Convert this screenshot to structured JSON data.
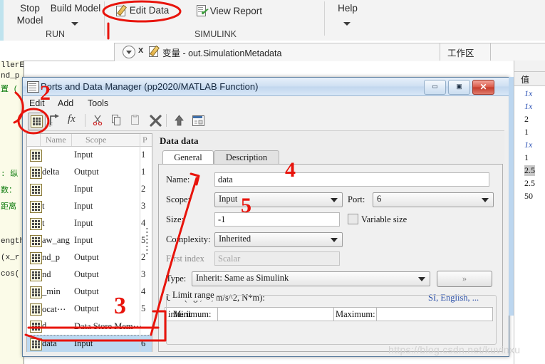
{
  "ribbon": {
    "groups": [
      {
        "caption": "RUN",
        "items": [
          {
            "label_line1": "Stop",
            "label_line2": "Model",
            "icon": "stop-model-icon"
          },
          {
            "label_line1": "Build Model",
            "label_line2": "",
            "icon": "build-model-icon",
            "has_caret": true
          }
        ]
      },
      {
        "caption": "SIMULINK",
        "items": [
          {
            "label_line1": "Edit Data",
            "label_line2": "",
            "icon": "edit-data-icon"
          },
          {
            "label_line1": "View Report",
            "label_line2": "",
            "icon": "view-report-icon"
          }
        ]
      }
    ],
    "help": {
      "label": "Help",
      "has_caret": true
    },
    "run_caption": "RUN",
    "simulink_caption": "SIMULINK",
    "stop_model_l1": "Stop",
    "stop_model_l2": "Model",
    "build_model": "Build Model",
    "edit_data": "Edit Data",
    "view_report": "View Report"
  },
  "tabstrip": {
    "close_glyph": "x",
    "doc_label": "变量 - out.SimulationMetadata",
    "workspace_label": "工作区"
  },
  "bg_editor": {
    "lines": [
      "nd_p",
      "置 (",
      "",
      "",
      ": 纵",
      "数：",
      "距离",
      "",
      "ength",
      "(x_r",
      "cos("
    ],
    "top_line": "llerE"
  },
  "bg_workspace": {
    "header": "值",
    "values": [
      "1x",
      "1x",
      "2",
      "1",
      "1x",
      "1",
      "2.5",
      "2.5",
      "50"
    ],
    "selected_index": 6
  },
  "dialog": {
    "title": "Ports and Data Manager (pp2020/MATLAB Function)",
    "title_icon": "grid-table-icon",
    "window_buttons": {
      "minimize": "minimize-button",
      "maximize": "maximize-button",
      "close": "close-button",
      "close_glyph": "✕"
    },
    "menu": [
      "Edit",
      "Add",
      "Tools"
    ],
    "toolbar": [
      {
        "name": "add-data-icon",
        "pressed": true
      },
      {
        "name": "add-event-icon",
        "pressed": false
      },
      {
        "name": "add-function-icon",
        "pressed": false
      },
      {
        "name": "cut-icon",
        "pressed": false
      },
      {
        "name": "copy-icon",
        "pressed": false
      },
      {
        "name": "paste-icon",
        "pressed": false
      },
      {
        "name": "delete-icon",
        "pressed": false
      },
      {
        "name": "move-up-icon",
        "pressed": false
      },
      {
        "name": "model-explorer-icon",
        "pressed": false
      }
    ],
    "list": {
      "headers": [
        "Name",
        "Scope",
        "P"
      ],
      "rows": [
        {
          "name": "",
          "scope": "Input",
          "port": "1",
          "selected": false
        },
        {
          "name": "delta",
          "scope": "Output",
          "port": "1",
          "selected": false
        },
        {
          "name": "",
          "scope": "Input",
          "port": "2",
          "selected": false
        },
        {
          "name": "t",
          "scope": "Input",
          "port": "3",
          "selected": false
        },
        {
          "name": "t",
          "scope": "Input",
          "port": "4",
          "selected": false
        },
        {
          "name": "aw_ang",
          "scope": "Input",
          "port": "5",
          "selected": false
        },
        {
          "name": "nd_p",
          "scope": "Output",
          "port": "2",
          "selected": false
        },
        {
          "name": "nd",
          "scope": "Output",
          "port": "3",
          "selected": false
        },
        {
          "name": "_min",
          "scope": "Output",
          "port": "4",
          "selected": false
        },
        {
          "name": "ocat⋯",
          "scope": "Output",
          "port": "5",
          "selected": false
        },
        {
          "name": "d",
          "scope": "Data Store Mem⋯",
          "port": "",
          "selected": false
        },
        {
          "name": "data",
          "scope": "Input",
          "port": "6",
          "selected": true
        }
      ]
    },
    "props": {
      "title": "Data data",
      "tabs": [
        {
          "label": "General",
          "active": true
        },
        {
          "label": "Description",
          "active": false
        }
      ],
      "fields": {
        "name_label": "Name:",
        "name_value": "data",
        "scope_label": "Scope:",
        "scope_value": "Input",
        "port_label": "Port:",
        "port_value": "6",
        "size_label": "Size:",
        "size_value": "-1",
        "variable_size_label": "Variable size",
        "variable_size_checked": false,
        "complexity_label": "Complexity:",
        "complexity_value": "Inherited",
        "first_index_label": "First index",
        "first_index_value": "Scalar",
        "type_label": "Type:",
        "type_value": "Inherit: Same as Simulink",
        "type_button_label": "»",
        "unit_label": "Unit (e.g., m, m/s^2, N*m):",
        "unit_link": "SI, English, ...",
        "unit_value": "inherit",
        "limit_group_label": "Limit range",
        "minimum_label": "Minimum:",
        "minimum_value": "",
        "maximum_label": "Maximum:",
        "maximum_value": ""
      }
    }
  },
  "annotations": {
    "numbers": [
      "2",
      "4",
      "5",
      "3"
    ],
    "color": "#e8140c",
    "note": "red hand-drawn markup circling Edit Data, the add-data toolbar button, the selected data row, and arrows to Name / Scope fields"
  },
  "watermark": "https://blog.csdn.net/kuvinxu"
}
